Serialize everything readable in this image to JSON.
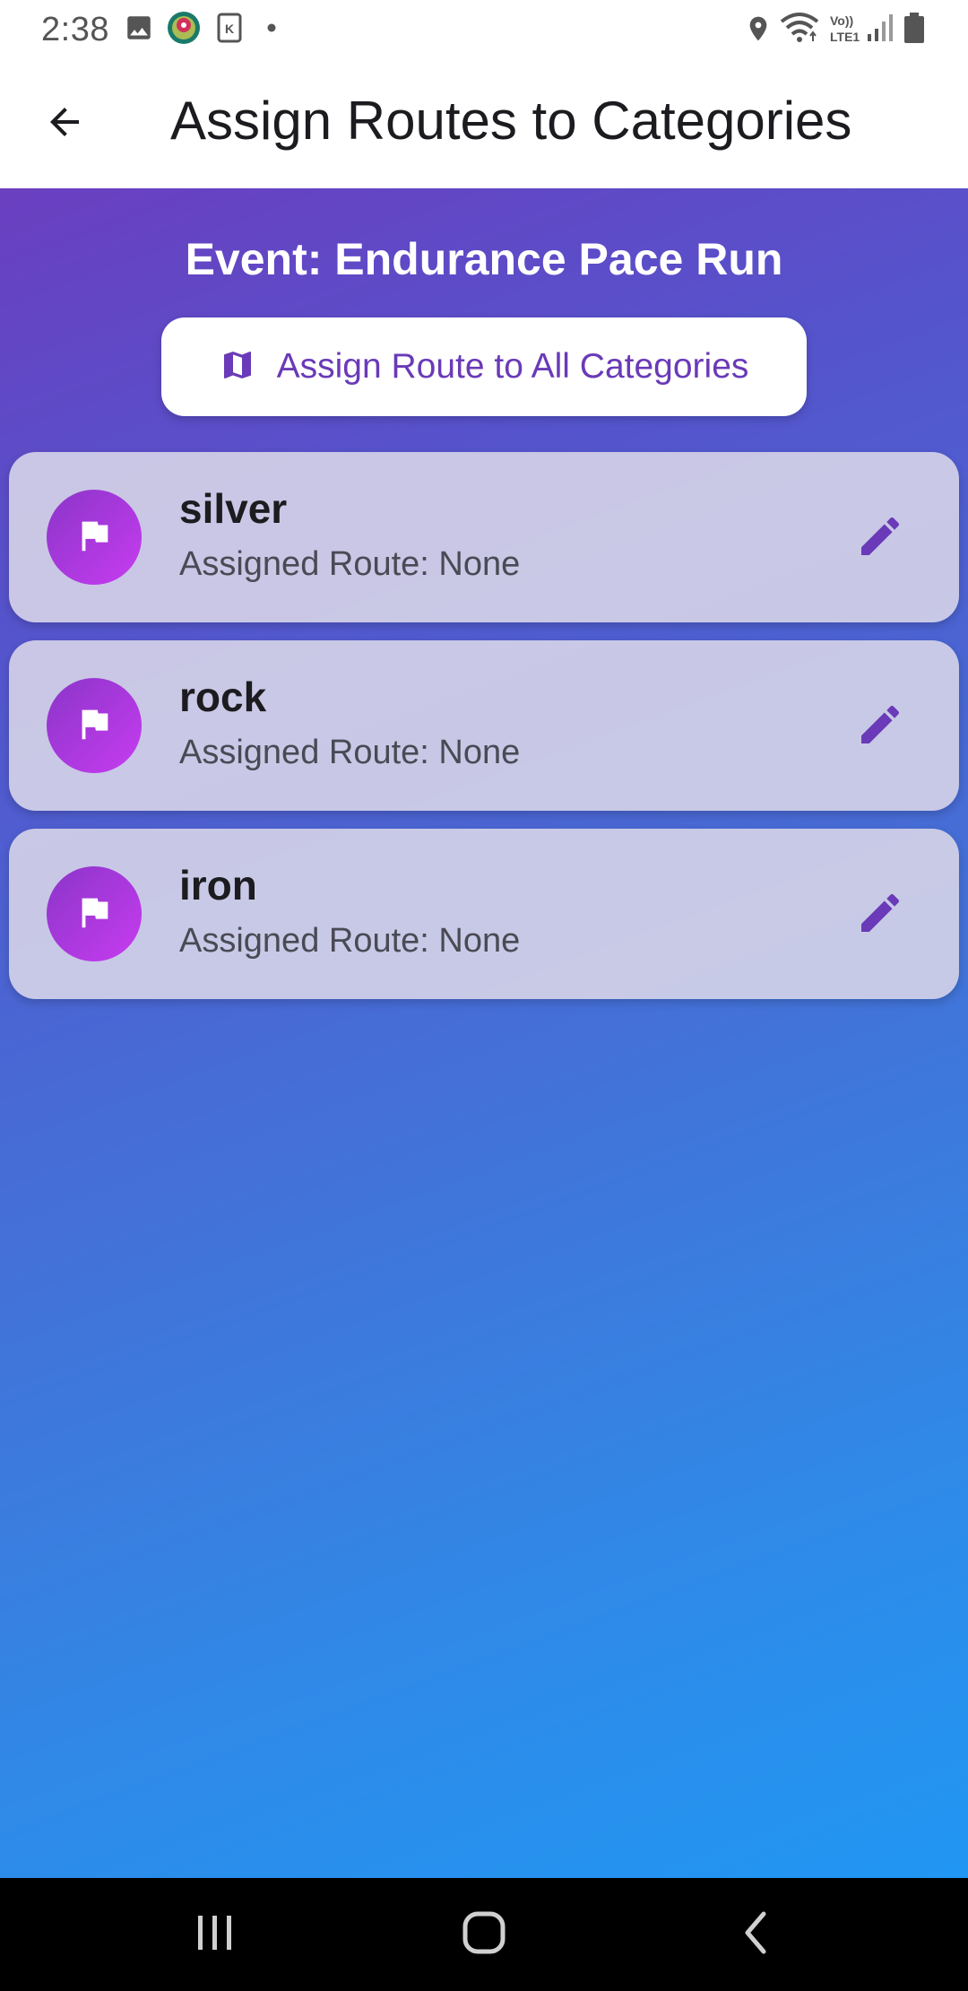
{
  "status_bar": {
    "time": "2:38",
    "left_icons": [
      "image-icon",
      "app-notification-icon",
      "k-app-icon",
      "dot-icon"
    ],
    "right_icons": [
      "location-icon",
      "wifi-icon",
      "volte-icon",
      "signal-icon",
      "battery-icon"
    ],
    "volte_label_top": "Vo))",
    "volte_label_bottom": "LTE1"
  },
  "app_bar": {
    "title": "Assign Routes to Categories",
    "back_icon": "arrow-back-icon"
  },
  "main": {
    "event_title": "Event: Endurance Pace Run",
    "assign_all": {
      "label": "Assign Route to All Categories",
      "icon": "map-icon"
    },
    "categories": [
      {
        "name": "silver",
        "route": "Assigned Route: None",
        "icon": "flag-icon",
        "action_icon": "edit-icon"
      },
      {
        "name": "rock",
        "route": "Assigned Route: None",
        "icon": "flag-icon",
        "action_icon": "edit-icon"
      },
      {
        "name": "iron",
        "route": "Assigned Route: None",
        "icon": "flag-icon",
        "action_icon": "edit-icon"
      }
    ]
  },
  "nav_bar": {
    "buttons": [
      "recents-icon",
      "home-icon",
      "back-icon"
    ]
  },
  "colors": {
    "accent": "#6a3ab8",
    "gradient_start": "#6a3fc0",
    "gradient_end": "#2196f3",
    "card_background": "#d6d4e8"
  }
}
